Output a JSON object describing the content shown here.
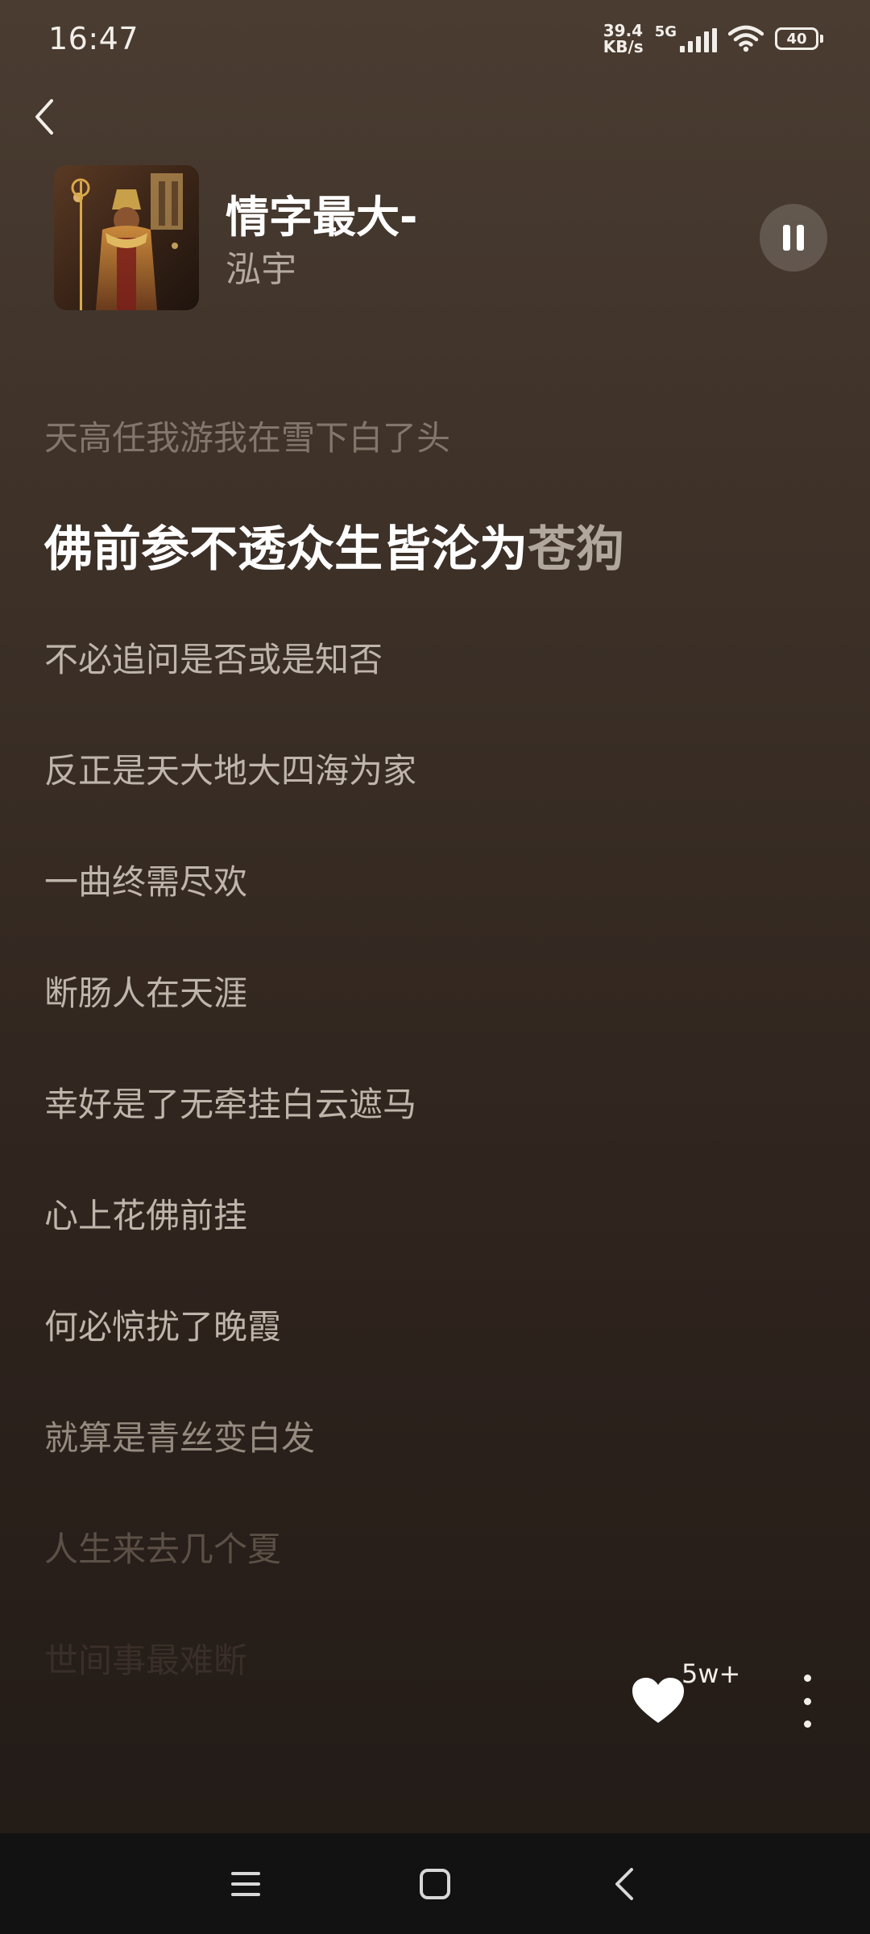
{
  "status_bar": {
    "time": "16:47",
    "net_speed_value": "39.4",
    "net_speed_unit": "KB/s",
    "network_type": "5G",
    "battery_level": "40"
  },
  "song": {
    "title": "情字最大-",
    "artist": "泓宇",
    "playing": true
  },
  "lyrics": {
    "previous": "天高任我游我在雪下白了头",
    "current_sung": "佛前参不透众生皆沦为",
    "current_unsung": "苍狗",
    "upcoming": [
      "不必追问是否或是知否",
      "反正是天大地大四海为家",
      "一曲终需尽欢",
      "断肠人在天涯",
      "幸好是了无牵挂白云遮马",
      "心上花佛前挂",
      "何必惊扰了晚霞",
      "就算是青丝变白发",
      "人生来去几个夏",
      "世间事最难断"
    ]
  },
  "actions": {
    "like_count": "5w+"
  },
  "colors": {
    "background_top": "#4a3c31",
    "background_bottom": "#211a16",
    "lyric_active": "#ffffff",
    "lyric_inactive": "#bfb5ab",
    "nav_bar": "#121212"
  },
  "icons": {
    "back": "chevron-left-icon",
    "pause": "pause-icon",
    "like": "heart-icon",
    "more": "more-vertical-icon",
    "nav_menu": "menu-icon",
    "nav_home": "home-square-icon",
    "nav_back": "back-chevron-icon"
  }
}
